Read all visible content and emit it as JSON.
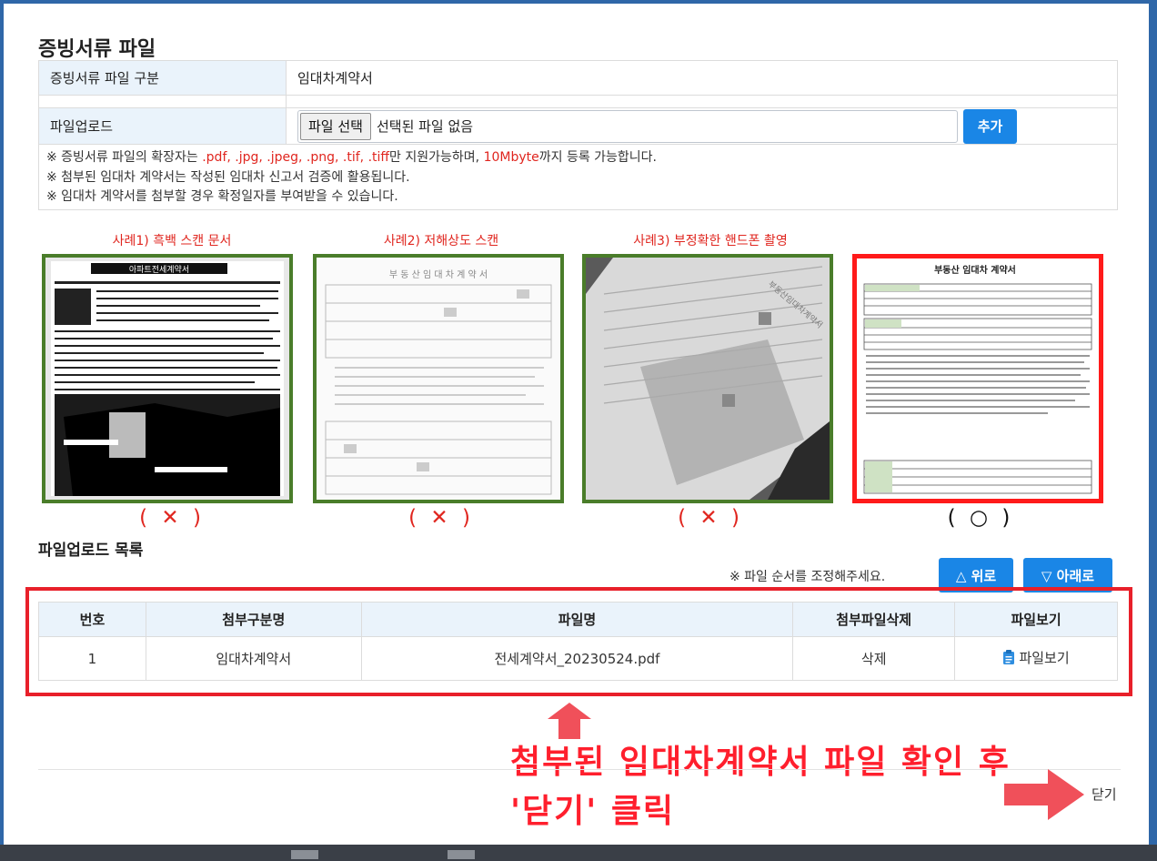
{
  "section_title": "증빙서류 파일",
  "form": {
    "category_label": "증빙서류 파일 구분",
    "category_value": "임대차계약서",
    "upload_label": "파일업로드",
    "file_button": "파일 선택",
    "file_status": "선택된 파일 없음",
    "add_button": "추가"
  },
  "notes": {
    "line1_prefix": "※ 증빙서류 파일의 확장자는 ",
    "line1_exts": ".pdf, .jpg, .jpeg, .png, .tif, .tiff",
    "line1_mid": "만 지원가능하며, ",
    "line1_size": "10Mbyte",
    "line1_suffix": "까지 등록 가능합니다.",
    "line2": "※ 첨부된 임대차 계약서는 작성된 임대차 신고서 검증에 활용됩니다.",
    "line3": "※ 임대차 계약서를 첨부할 경우 확정일자를 부여받을 수 있습니다."
  },
  "samples": [
    {
      "caption": "사례1) 흑백 스캔 문서",
      "mark": "( ✕ )",
      "doc_title": "아파트전세계약서"
    },
    {
      "caption": "사례2) 저해상도 스캔",
      "mark": "( ✕ )",
      "doc_title": "부 동 산 임 대 차 계 약 서"
    },
    {
      "caption": "사례3) 부정확한 핸드폰 촬영",
      "mark": "( ✕ )",
      "doc_title": "부동산임대차계약서"
    },
    {
      "caption": "",
      "mark": "( ○ )",
      "doc_title": "부동산 임대차 계약서"
    }
  ],
  "upload_list": {
    "title": "파일업로드 목록",
    "order_hint": "※ 파일 순서를 조정해주세요.",
    "up_button": "△ 위로",
    "down_button": "▽ 아래로",
    "columns": [
      "번호",
      "첨부구분명",
      "파일명",
      "첨부파일삭제",
      "파일보기"
    ],
    "rows": [
      {
        "no": "1",
        "category": "임대차계약서",
        "filename": "전세계약서_20230524.pdf",
        "delete": "삭제",
        "view": "파일보기"
      }
    ]
  },
  "annotation": {
    "line1": "첨부된 임대차계약서 파일 확인 후",
    "line2": "'닫기' 클릭"
  },
  "close_button": "닫기",
  "colors": {
    "primary_button": "#1a86e6",
    "highlight_red": "#e8202a",
    "header_bg": "#eaf3fb",
    "bad_frame": "#4a7d2a"
  }
}
